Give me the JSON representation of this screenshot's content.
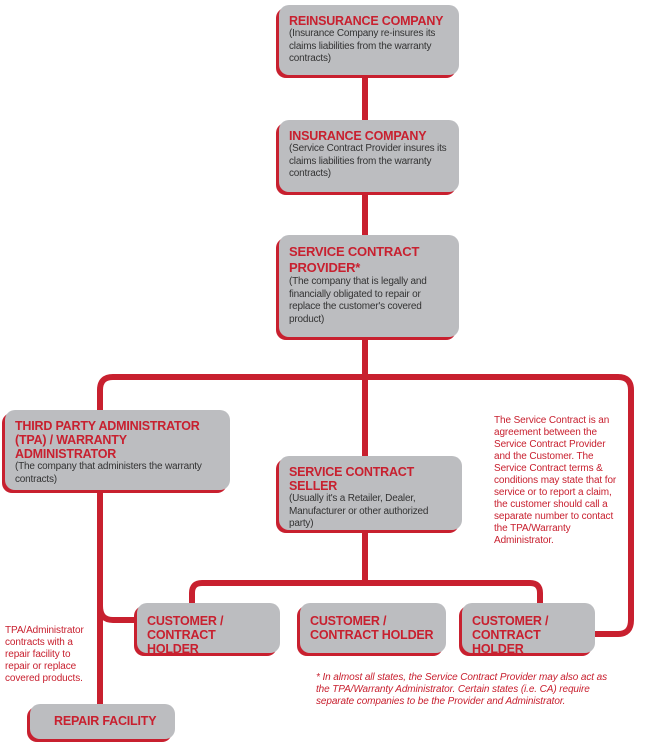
{
  "colors": {
    "accent": "#c8202f",
    "box_fill": "#bcbdc0",
    "body_text": "#333333"
  },
  "nodes": {
    "reinsurance": {
      "title": "REINSURANCE COMPANY",
      "desc": "(Insurance Company re-insures its claims liabilities from the warranty contracts)"
    },
    "insurance": {
      "title": "INSURANCE COMPANY",
      "desc": "(Service Contract Provider insures its claims liabilities from the warranty contracts)"
    },
    "provider": {
      "title": "SERVICE CONTRACT PROVIDER*",
      "desc": "(The company that is legally and financially obligated to repair or replace the customer's covered product)"
    },
    "tpa": {
      "title": "THIRD PARTY ADMINISTRATOR (TPA) / WARRANTY ADMINISTRATOR",
      "desc": "(The company that administers the warranty contracts)"
    },
    "seller": {
      "title": "SERVICE CONTRACT SELLER",
      "desc": "(Usually it's a Retailer, Dealer, Manufacturer or other authorized party)"
    },
    "customers": [
      {
        "title": "CUSTOMER / CONTRACT HOLDER"
      },
      {
        "title": "CUSTOMER / CONTRACT HOLDER"
      },
      {
        "title": "CUSTOMER / CONTRACT HOLDER"
      }
    ],
    "repair": {
      "title": "REPAIR FACILITY"
    }
  },
  "notes": {
    "service_contract": "The Service Contract is an agreement between the Service Contract Provider and the Customer. The Service Contract terms & conditions may state that for service or to report a claim, the customer should call a separate number to contact the TPA/Warranty Administrator.",
    "repair": "TPA/Administrator contracts with a repair facility to repair or replace covered products.",
    "footnote": "* In almost all states, the Service Contract Provider may also act as the TPA/Warranty Administrator. Certain states (i.e. CA) require separate companies to be the Provider and Administrator."
  }
}
